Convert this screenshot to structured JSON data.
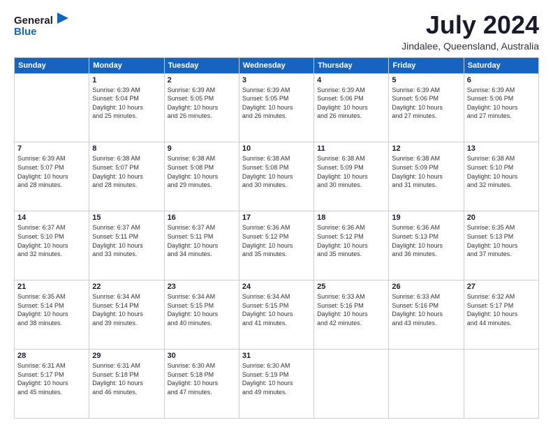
{
  "header": {
    "logo_line1": "General",
    "logo_line2": "Blue",
    "month": "July 2024",
    "location": "Jindalee, Queensland, Australia"
  },
  "weekdays": [
    "Sunday",
    "Monday",
    "Tuesday",
    "Wednesday",
    "Thursday",
    "Friday",
    "Saturday"
  ],
  "weeks": [
    [
      {
        "day": "",
        "info": ""
      },
      {
        "day": "1",
        "info": "Sunrise: 6:39 AM\nSunset: 5:04 PM\nDaylight: 10 hours\nand 25 minutes."
      },
      {
        "day": "2",
        "info": "Sunrise: 6:39 AM\nSunset: 5:05 PM\nDaylight: 10 hours\nand 26 minutes."
      },
      {
        "day": "3",
        "info": "Sunrise: 6:39 AM\nSunset: 5:05 PM\nDaylight: 10 hours\nand 26 minutes."
      },
      {
        "day": "4",
        "info": "Sunrise: 6:39 AM\nSunset: 5:06 PM\nDaylight: 10 hours\nand 26 minutes."
      },
      {
        "day": "5",
        "info": "Sunrise: 6:39 AM\nSunset: 5:06 PM\nDaylight: 10 hours\nand 27 minutes."
      },
      {
        "day": "6",
        "info": "Sunrise: 6:39 AM\nSunset: 5:06 PM\nDaylight: 10 hours\nand 27 minutes."
      }
    ],
    [
      {
        "day": "7",
        "info": "Sunrise: 6:39 AM\nSunset: 5:07 PM\nDaylight: 10 hours\nand 28 minutes."
      },
      {
        "day": "8",
        "info": "Sunrise: 6:38 AM\nSunset: 5:07 PM\nDaylight: 10 hours\nand 28 minutes."
      },
      {
        "day": "9",
        "info": "Sunrise: 6:38 AM\nSunset: 5:08 PM\nDaylight: 10 hours\nand 29 minutes."
      },
      {
        "day": "10",
        "info": "Sunrise: 6:38 AM\nSunset: 5:08 PM\nDaylight: 10 hours\nand 30 minutes."
      },
      {
        "day": "11",
        "info": "Sunrise: 6:38 AM\nSunset: 5:09 PM\nDaylight: 10 hours\nand 30 minutes."
      },
      {
        "day": "12",
        "info": "Sunrise: 6:38 AM\nSunset: 5:09 PM\nDaylight: 10 hours\nand 31 minutes."
      },
      {
        "day": "13",
        "info": "Sunrise: 6:38 AM\nSunset: 5:10 PM\nDaylight: 10 hours\nand 32 minutes."
      }
    ],
    [
      {
        "day": "14",
        "info": "Sunrise: 6:37 AM\nSunset: 5:10 PM\nDaylight: 10 hours\nand 32 minutes."
      },
      {
        "day": "15",
        "info": "Sunrise: 6:37 AM\nSunset: 5:11 PM\nDaylight: 10 hours\nand 33 minutes."
      },
      {
        "day": "16",
        "info": "Sunrise: 6:37 AM\nSunset: 5:11 PM\nDaylight: 10 hours\nand 34 minutes."
      },
      {
        "day": "17",
        "info": "Sunrise: 6:36 AM\nSunset: 5:12 PM\nDaylight: 10 hours\nand 35 minutes."
      },
      {
        "day": "18",
        "info": "Sunrise: 6:36 AM\nSunset: 5:12 PM\nDaylight: 10 hours\nand 35 minutes."
      },
      {
        "day": "19",
        "info": "Sunrise: 6:36 AM\nSunset: 5:13 PM\nDaylight: 10 hours\nand 36 minutes."
      },
      {
        "day": "20",
        "info": "Sunrise: 6:35 AM\nSunset: 5:13 PM\nDaylight: 10 hours\nand 37 minutes."
      }
    ],
    [
      {
        "day": "21",
        "info": "Sunrise: 6:35 AM\nSunset: 5:14 PM\nDaylight: 10 hours\nand 38 minutes."
      },
      {
        "day": "22",
        "info": "Sunrise: 6:34 AM\nSunset: 5:14 PM\nDaylight: 10 hours\nand 39 minutes."
      },
      {
        "day": "23",
        "info": "Sunrise: 6:34 AM\nSunset: 5:15 PM\nDaylight: 10 hours\nand 40 minutes."
      },
      {
        "day": "24",
        "info": "Sunrise: 6:34 AM\nSunset: 5:15 PM\nDaylight: 10 hours\nand 41 minutes."
      },
      {
        "day": "25",
        "info": "Sunrise: 6:33 AM\nSunset: 5:16 PM\nDaylight: 10 hours\nand 42 minutes."
      },
      {
        "day": "26",
        "info": "Sunrise: 6:33 AM\nSunset: 5:16 PM\nDaylight: 10 hours\nand 43 minutes."
      },
      {
        "day": "27",
        "info": "Sunrise: 6:32 AM\nSunset: 5:17 PM\nDaylight: 10 hours\nand 44 minutes."
      }
    ],
    [
      {
        "day": "28",
        "info": "Sunrise: 6:31 AM\nSunset: 5:17 PM\nDaylight: 10 hours\nand 45 minutes."
      },
      {
        "day": "29",
        "info": "Sunrise: 6:31 AM\nSunset: 5:18 PM\nDaylight: 10 hours\nand 46 minutes."
      },
      {
        "day": "30",
        "info": "Sunrise: 6:30 AM\nSunset: 5:18 PM\nDaylight: 10 hours\nand 47 minutes."
      },
      {
        "day": "31",
        "info": "Sunrise: 6:30 AM\nSunset: 5:19 PM\nDaylight: 10 hours\nand 49 minutes."
      },
      {
        "day": "",
        "info": ""
      },
      {
        "day": "",
        "info": ""
      },
      {
        "day": "",
        "info": ""
      }
    ]
  ]
}
